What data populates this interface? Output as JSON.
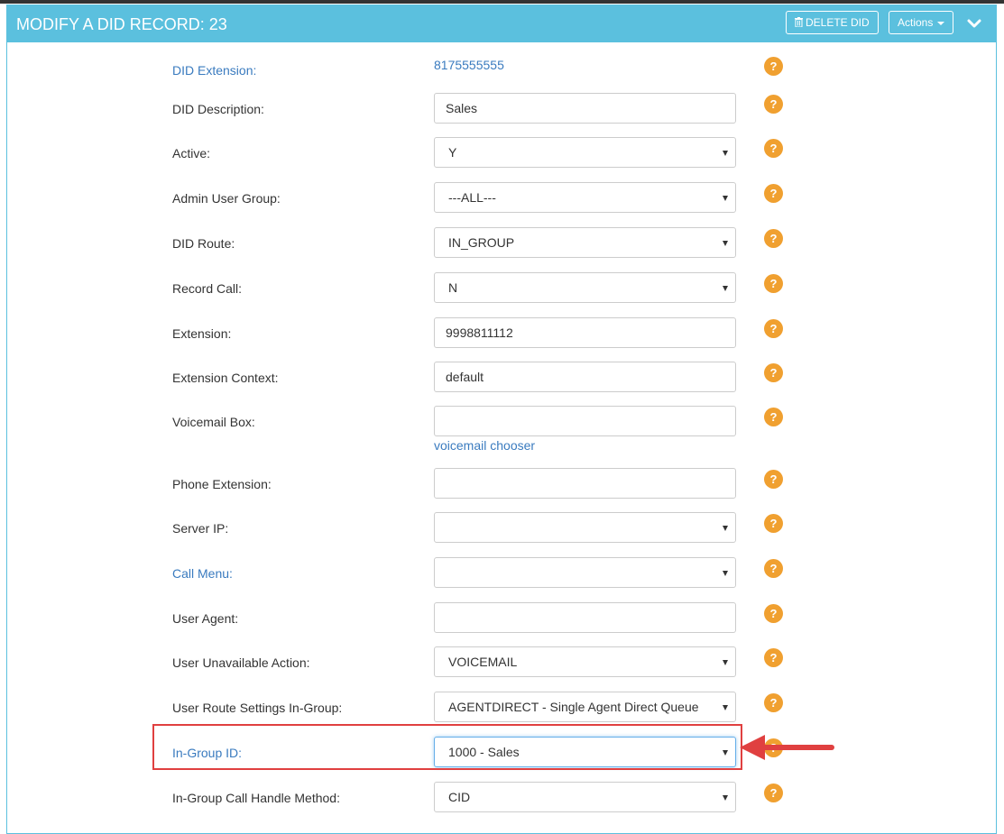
{
  "panel": {
    "title": "MODIFY A DID RECORD: 23",
    "delete_label": "DELETE DID",
    "actions_label": "Actions",
    "header_color": "#5bc0de"
  },
  "form": {
    "did_extension": {
      "label": "DID Extension:",
      "value": "8175555555"
    },
    "did_description": {
      "label": "DID Description:",
      "value": "Sales"
    },
    "active": {
      "label": "Active:",
      "value": "Y"
    },
    "admin_user_group": {
      "label": "Admin User Group:",
      "value": "---ALL---"
    },
    "did_route": {
      "label": "DID Route:",
      "value": "IN_GROUP"
    },
    "record_call": {
      "label": "Record Call:",
      "value": "N"
    },
    "extension": {
      "label": "Extension:",
      "value": "9998811112"
    },
    "extension_context": {
      "label": "Extension Context:",
      "value": "default"
    },
    "voicemail_box": {
      "label": "Voicemail Box:",
      "value": "",
      "chooser": "voicemail chooser"
    },
    "phone_extension": {
      "label": "Phone Extension:",
      "value": ""
    },
    "server_ip": {
      "label": "Server IP:",
      "value": ""
    },
    "call_menu": {
      "label": "Call Menu:",
      "value": ""
    },
    "user_agent": {
      "label": "User Agent:",
      "value": ""
    },
    "user_unavailable_action": {
      "label": "User Unavailable Action:",
      "value": "VOICEMAIL"
    },
    "user_route_settings_ingroup": {
      "label": "User Route Settings In-Group:",
      "value": "AGENTDIRECT - Single Agent Direct Queue"
    },
    "ingroup_id": {
      "label": "In-Group ID:",
      "value": "1000 - Sales"
    },
    "ingroup_call_handle_method": {
      "label": "In-Group Call Handle Method:",
      "value": "CID"
    }
  },
  "help_text": "?",
  "colors": {
    "help": "#f0a030",
    "link": "#3a7bbf",
    "highlight": "#e04040"
  }
}
